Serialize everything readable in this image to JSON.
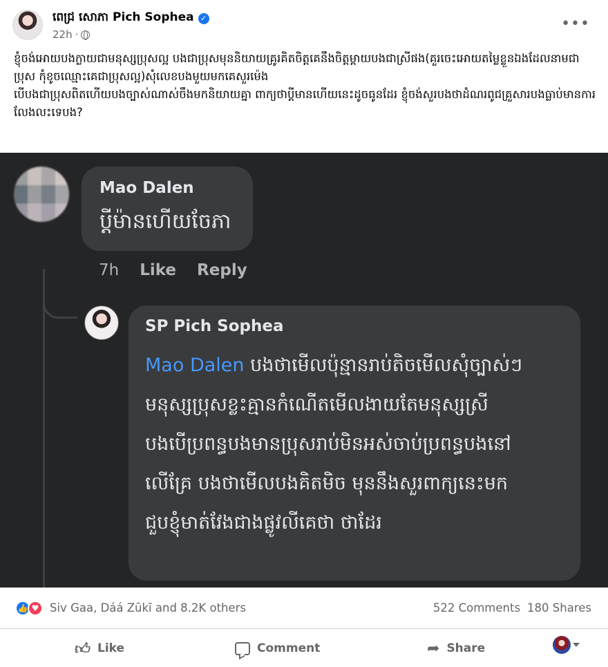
{
  "header": {
    "author": "ពេជ្រ សោភា Pich Sophea",
    "time": "22h",
    "separator": "·"
  },
  "post": {
    "text": "ខ្ញុំចង់អោយបងក្លាយជាមនុស្សប្រុសល្អ បងជាប្រុសមុននិយាយគ្រូរគិតចិត្តគេនឹងចិត្តម្ដាយបងជាស្រីផង(គួរចេះអោយតម្លៃខ្លួនឯងដែលនាមជាប្រុស កុំខូចឈ្មោះគេជាប្រុសល្អ)សុំលេខបងមួយមកគេសួរម៉េង\nបើបងជាប្រុសពិតហើយបងច្បាស់ណាស់ចឹងមកនិយាយគ្នា ពាក្យថាប្ដីមានហើយនេះដូចធូនដែរ ខ្ញុំចង់សួរបងថាដំណរពូជគ្រួសារបងធ្លាប់មានការលែងលះទេបង?"
  },
  "comment1": {
    "name": "Mao Dalen",
    "text": "ប្ដីម៉ានហើយចែភា",
    "time": "7h",
    "like": "Like",
    "reply": "Reply"
  },
  "comment2": {
    "name": "SP Pich Sophea",
    "mention": "Mao Dalen",
    "line1": " បងថាមើលប៉ុន្មានរាប់តិចមើលសុំច្បាស់ៗ",
    "line2": "មនុស្សប្រុសខ្លះគ្មានកំណើតមើលងាយតែមនុស្សស្រី",
    "line3": "បងបើប្រពន្ធបងមានប្រុសរាប់មិនអស់ចាប់ប្រពន្ធបងនៅ",
    "line4": "លើគ្រែ បងថាមើលបងគិតមិច មុននឹងសួរពាក្យនេះមក",
    "line5": "ជួបខ្ញុំមាត់វែងជាងផ្លូវលីគេថា ថាដែរ"
  },
  "reactions": {
    "people": "Siv Gaa, Dáá Zūkī and 8.2K others",
    "comments": "522 Comments",
    "shares": "180 Shares"
  },
  "actions": {
    "like": "Like",
    "comment": "Comment",
    "share": "Share"
  }
}
